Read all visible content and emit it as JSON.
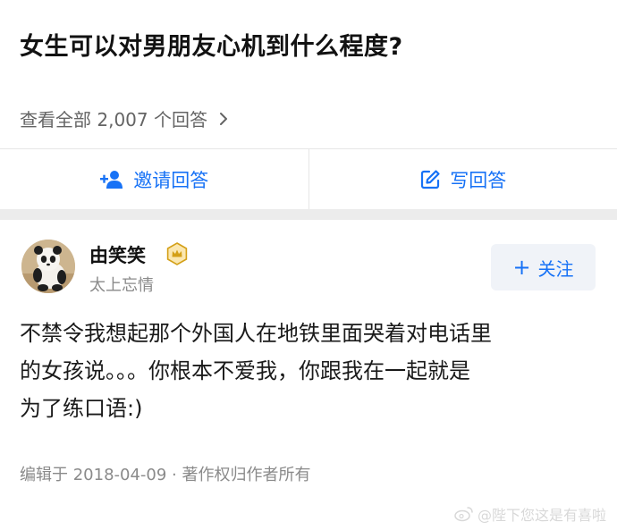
{
  "question": {
    "title": "女生可以对男朋友心机到什么程度?"
  },
  "view_all": {
    "label": "查看全部 2,007 个回答"
  },
  "actions": {
    "invite_label": "邀请回答",
    "write_label": "写回答"
  },
  "answer": {
    "author_name": "由笑笑",
    "author_bio": "太上忘情",
    "follow_label": "关注",
    "text_lines": [
      "不禁令我想起那个外国人在地铁里面哭着对电话里",
      "的女孩说。。。你根本不爱我，你跟我在一起就是",
      "为了练口语:)"
    ],
    "meta": "编辑于 2018-04-09 · 著作权归作者所有"
  },
  "watermark": {
    "text": "@陛下您这是有喜啦"
  },
  "colors": {
    "accent": "#1772f6",
    "badge": "#d4a017",
    "secondary_text": "#8a8a8a"
  },
  "icons": {
    "invite": "add-person-icon",
    "write": "edit-icon",
    "chevron": "chevron-right-icon",
    "badge": "crown-badge-icon",
    "plus": "plus-icon"
  }
}
